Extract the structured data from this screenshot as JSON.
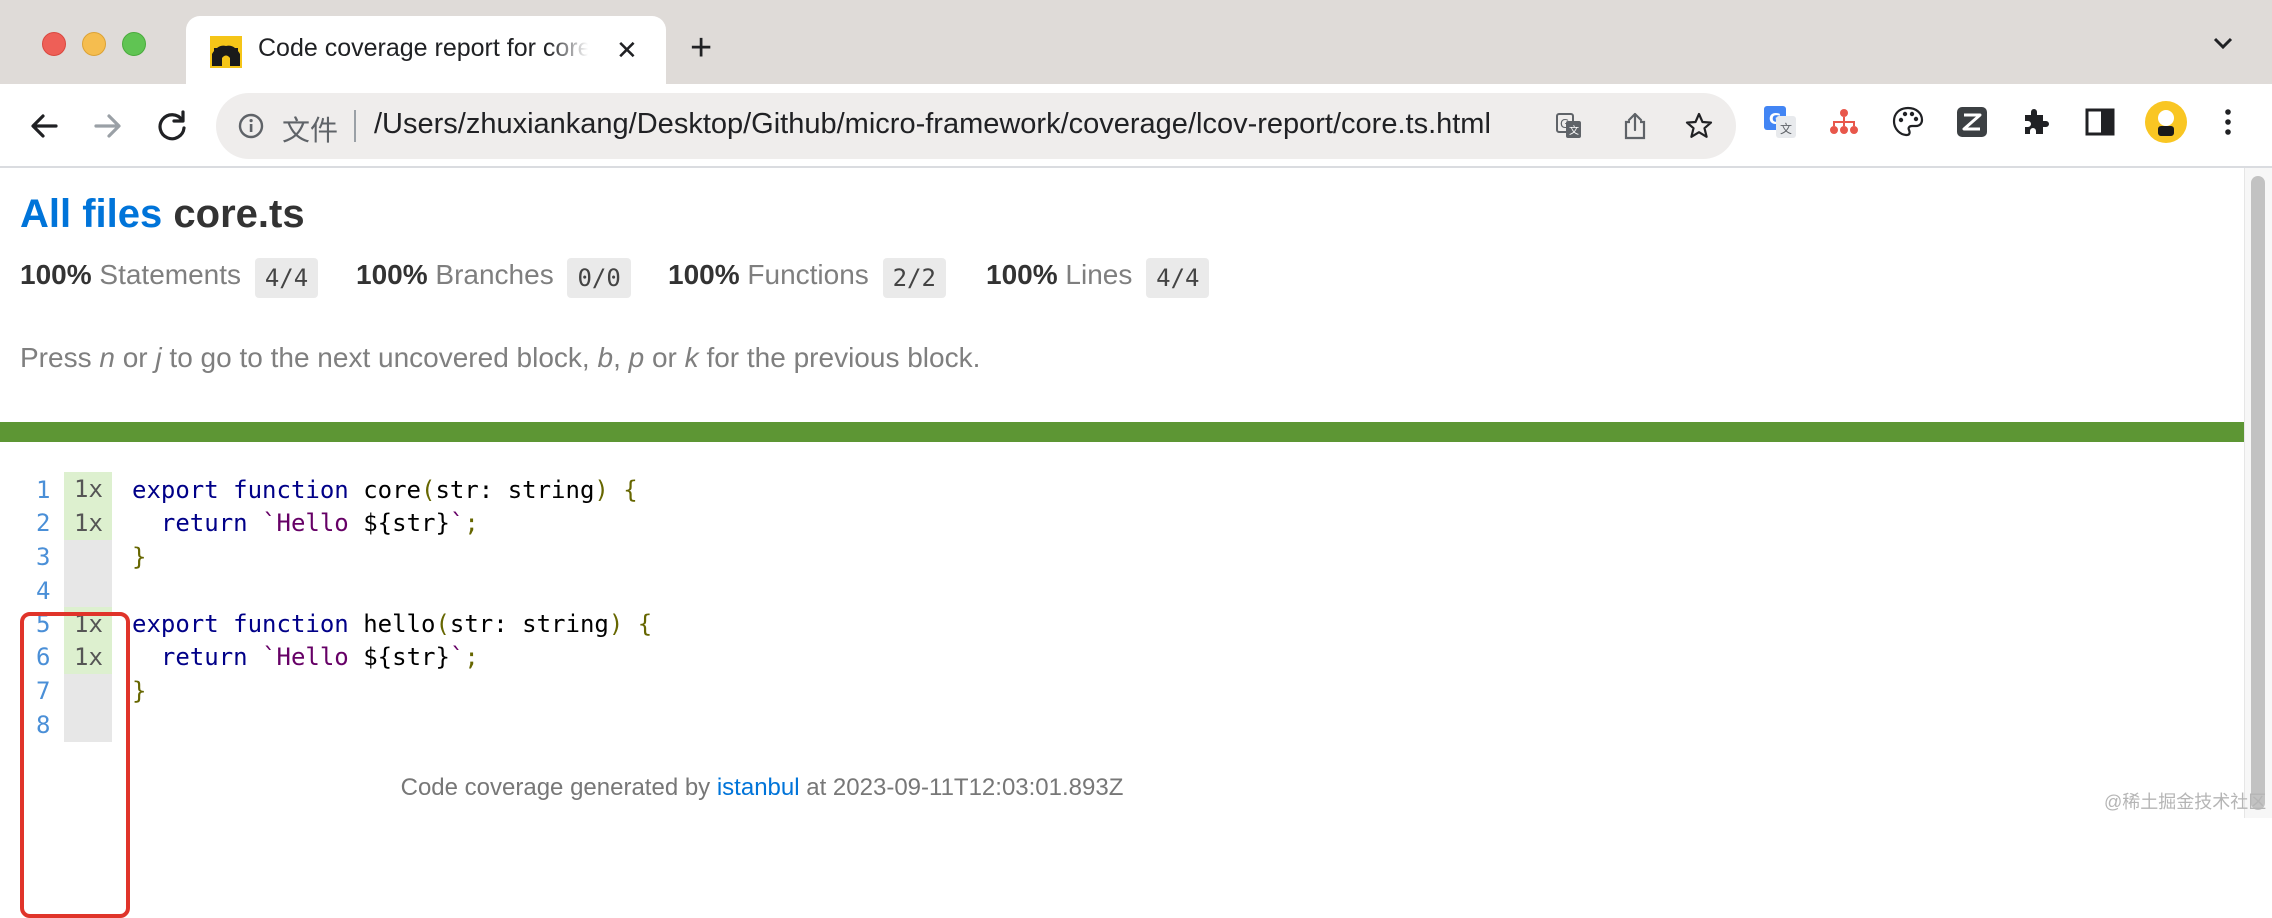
{
  "window": {
    "tab_title": "Code coverage report for core.ts",
    "close_label": "✕",
    "new_tab_label": "+"
  },
  "toolbar": {
    "scheme_label": "文件",
    "url": "/Users/zhuxiankang/Desktop/Github/micro-framework/coverage/lcov-report/core.ts.html"
  },
  "icons": [
    "back-icon",
    "forward-icon",
    "reload-icon",
    "info-icon",
    "translate-icon",
    "share-icon",
    "bookmark-star-icon",
    "google-translate-extension-icon",
    "sitemap-extension-icon",
    "palette-extension-icon",
    "z-extension-icon",
    "extensions-puzzle-icon",
    "side-panel-icon",
    "profile-avatar-icon",
    "more-menu-icon"
  ],
  "breadcrumb": {
    "all_files": "All files",
    "file": "core.ts"
  },
  "stats": [
    {
      "pct": "100%",
      "label": "Statements",
      "fraction": "4/4"
    },
    {
      "pct": "100%",
      "label": "Branches",
      "fraction": "0/0"
    },
    {
      "pct": "100%",
      "label": "Functions",
      "fraction": "2/2"
    },
    {
      "pct": "100%",
      "label": "Lines",
      "fraction": "4/4"
    }
  ],
  "hint": {
    "t1": "Press ",
    "k1": "n",
    "t2": " or ",
    "k2": "j",
    "t3": " to go to the next uncovered block, ",
    "k3": "b",
    "t4": ", ",
    "k4": "p",
    "t5": " or ",
    "k5": "k",
    "t6": " for the previous block."
  },
  "code": {
    "line_numbers": [
      "1",
      "2",
      "3",
      "4",
      "5",
      "6",
      "7",
      "8"
    ],
    "hits": [
      "1x",
      "1x",
      "",
      "",
      "1x",
      "1x",
      "",
      ""
    ],
    "lines": [
      {
        "kw": "export function",
        "rest": " core",
        "p1": "(",
        "arg": "str: string",
        "p2": ") {"
      },
      {
        "kw": "return",
        "str1": "`Hello ",
        "interp": "${str}",
        "str2": "`",
        "end": ";"
      },
      {
        "p": "}"
      },
      {},
      {
        "kw": "export function",
        "rest": " hello",
        "p1": "(",
        "arg": "str: string",
        "p2": ") {"
      },
      {
        "kw": "return",
        "str1": "`Hello ",
        "interp": "${str}",
        "str2": "`",
        "end": ";"
      },
      {
        "p": "}"
      },
      {}
    ]
  },
  "footer": {
    "prefix": "Code coverage generated by ",
    "link": "istanbul",
    "suffix": " at 2023-09-11T12:03:01.893Z"
  },
  "watermark": "@稀土掘金技术社区",
  "colors": {
    "coverage_bar": "#5d9634",
    "covered_hit": "#ddf0cf",
    "link": "#0074d9",
    "highlight_box": "#e0342a"
  }
}
